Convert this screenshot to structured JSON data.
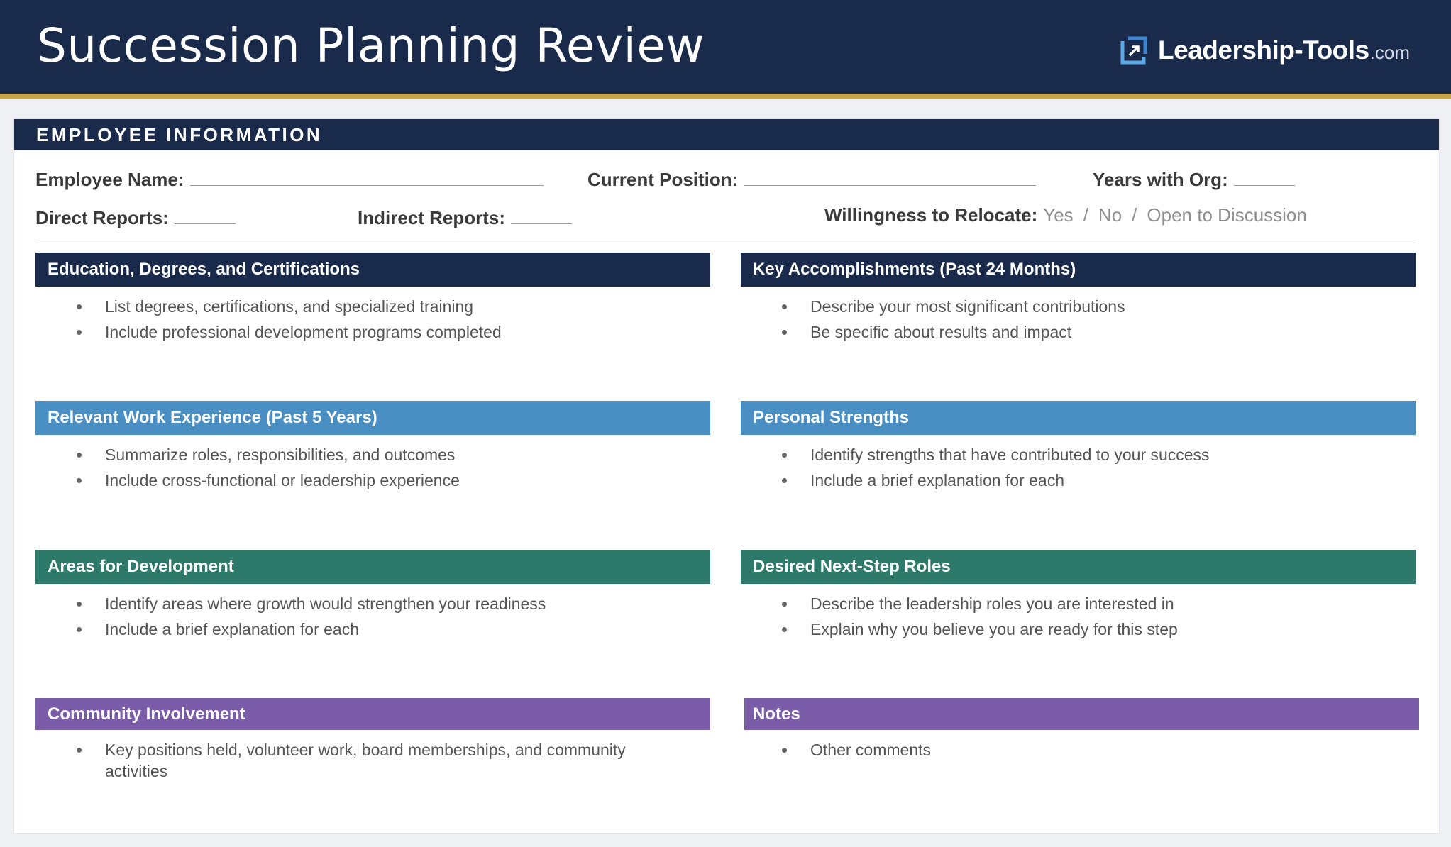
{
  "header": {
    "title": "Succession Planning Review",
    "brand_name": "Leadership-Tools",
    "brand_tld": ".com",
    "logo_icon": "corner-arrow-square-icon"
  },
  "employee_info": {
    "heading": "EMPLOYEE INFORMATION",
    "employee_name_label": "Employee Name:",
    "current_position_label": "Current Position:",
    "years_with_org_label": "Years with Org:",
    "direct_reports_label": "Direct Reports:",
    "indirect_reports_label": "Indirect Reports:",
    "relocate_label": "Willingness to Relocate:",
    "relocate_options": [
      "Yes",
      "No",
      "Open to Discussion"
    ],
    "relocate_separator": "/"
  },
  "sections": [
    {
      "title": "Education, Degrees, and Certifications",
      "color": "#1a2a4a",
      "items": [
        "List degrees, certifications, and specialized training",
        "Include professional development programs completed"
      ]
    },
    {
      "title": "Key Accomplishments (Past 24 Months)",
      "color": "#1a2a4a",
      "items": [
        "Describe your most significant contributions",
        "Be specific about results and impact"
      ]
    },
    {
      "title": "Relevant Work Experience (Past 5 Years)",
      "color": "#4a8fc4",
      "items": [
        "Summarize roles, responsibilities, and outcomes",
        "Include cross-functional or leadership experience"
      ]
    },
    {
      "title": "Personal Strengths",
      "color": "#4a8fc4",
      "items": [
        "Identify strengths that have contributed to your success",
        "Include a brief explanation for each"
      ]
    },
    {
      "title": "Areas for Development",
      "color": "#2e7a6a",
      "items": [
        "Identify areas where growth would strengthen your readiness",
        "Include a brief explanation for each"
      ]
    },
    {
      "title": "Desired Next-Step Roles",
      "color": "#2e7a6a",
      "items": [
        "Describe the leadership roles you are interested in",
        "Explain why you believe you are ready for this step"
      ]
    },
    {
      "title": "Community Involvement",
      "color": "#7b5ca8",
      "items": [
        "Key positions held, volunteer work, board memberships, and community activities"
      ]
    },
    {
      "title": "Notes",
      "color": "#7b5ca8",
      "items": [
        "Other comments"
      ]
    }
  ]
}
